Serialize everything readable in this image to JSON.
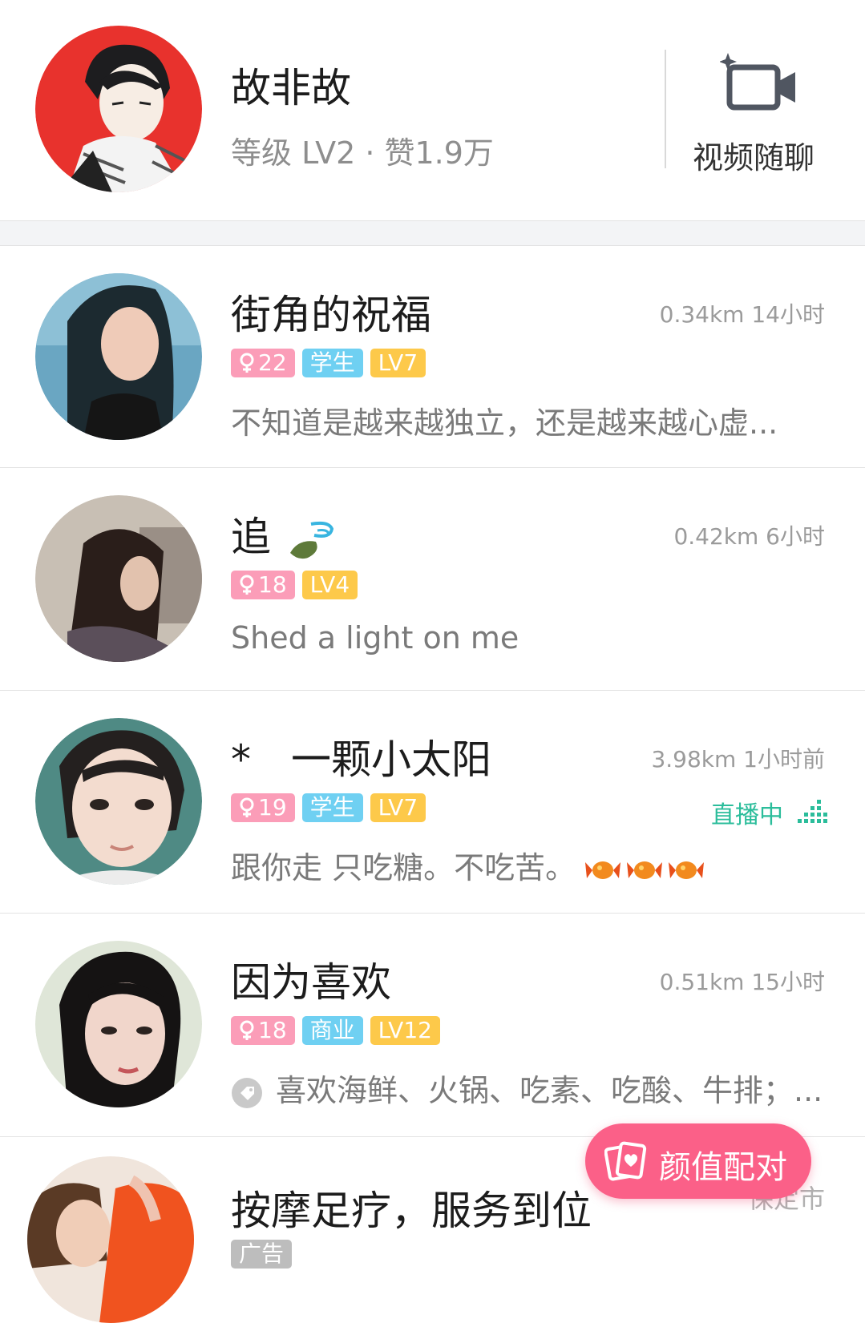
{
  "header": {
    "name": "故非故",
    "subtitle": "等级 LV2 · 赞1.9万",
    "video_label": "视频随聊"
  },
  "users": [
    {
      "name": "街角的祝福",
      "meta": "0.34km 14小时",
      "age": "22",
      "job": "学生",
      "level": "LV7",
      "desc": "不知道是越来越独立，还是越来越心虚..."
    },
    {
      "name": "追",
      "meta": "0.42km 6小时",
      "age": "18",
      "level": "LV4",
      "desc": "Shed a light on me"
    },
    {
      "name": "*　一颗小太阳",
      "meta": "3.98km 1小时前",
      "age": "19",
      "job": "学生",
      "level": "LV7",
      "live": "直播中",
      "desc": "跟你走 只吃糖。不吃苦。"
    },
    {
      "name": "因为喜欢",
      "meta": "0.51km 15小时",
      "age": "18",
      "job": "商业",
      "level": "LV12",
      "desc": "喜欢海鲜、火锅、吃素、吃酸、牛排；..."
    },
    {
      "name": "按摩足疗，服务到位",
      "meta": "保定市",
      "ad": "广告"
    }
  ],
  "fab": {
    "label": "颜值配对"
  },
  "colors": {
    "gender_badge": "#fb9db8",
    "job_badge": "#6fd0f2",
    "level_badge": "#fdc94a",
    "live_text": "#2bbd9b",
    "fab_bg": "#fb6088"
  }
}
